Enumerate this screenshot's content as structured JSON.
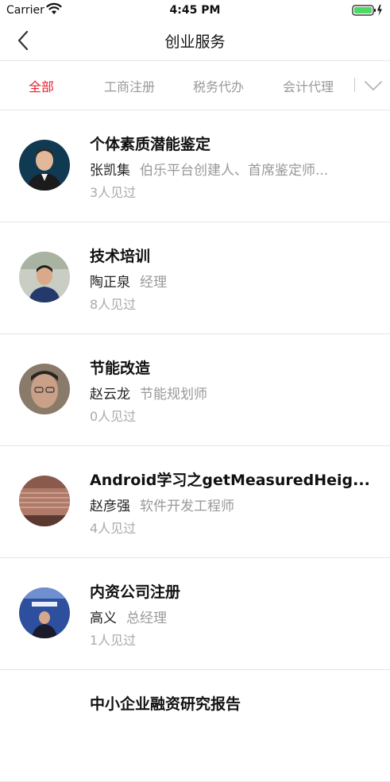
{
  "status_bar": {
    "carrier": "Carrier",
    "time": "4:45 PM"
  },
  "nav": {
    "title": "创业服务"
  },
  "tabs": [
    {
      "label": "全部",
      "active": true
    },
    {
      "label": "工商注册",
      "active": false
    },
    {
      "label": "税务代办",
      "active": false
    },
    {
      "label": "会计代理",
      "active": false
    }
  ],
  "items": [
    {
      "title": "个体素质潜能鉴定",
      "name": "张凯集",
      "role": "伯乐平台创建人、首席鉴定师...",
      "views": "3人见过"
    },
    {
      "title": "技术培训",
      "name": "陶正泉",
      "role": "经理",
      "views": "8人见过"
    },
    {
      "title": "节能改造",
      "name": "赵云龙",
      "role": "节能规划师",
      "views": "0人见过"
    },
    {
      "title": "Android学习之getMeasuredHeig...",
      "name": "赵彦强",
      "role": "软件开发工程师",
      "views": "4人见过"
    },
    {
      "title": "内资公司注册",
      "name": "高义",
      "role": "总经理",
      "views": "1人见过"
    },
    {
      "title": "中小企业融资研究报告",
      "name": "",
      "role": "",
      "views": ""
    }
  ],
  "colors": {
    "accent": "#e8222b",
    "muted": "#999999",
    "divider": "#e6e6e6",
    "battery": "#4cd964"
  },
  "icons": {
    "back": "chevron-left-icon",
    "more": "chevron-down-icon",
    "wifi": "wifi-icon",
    "battery": "battery-icon"
  }
}
